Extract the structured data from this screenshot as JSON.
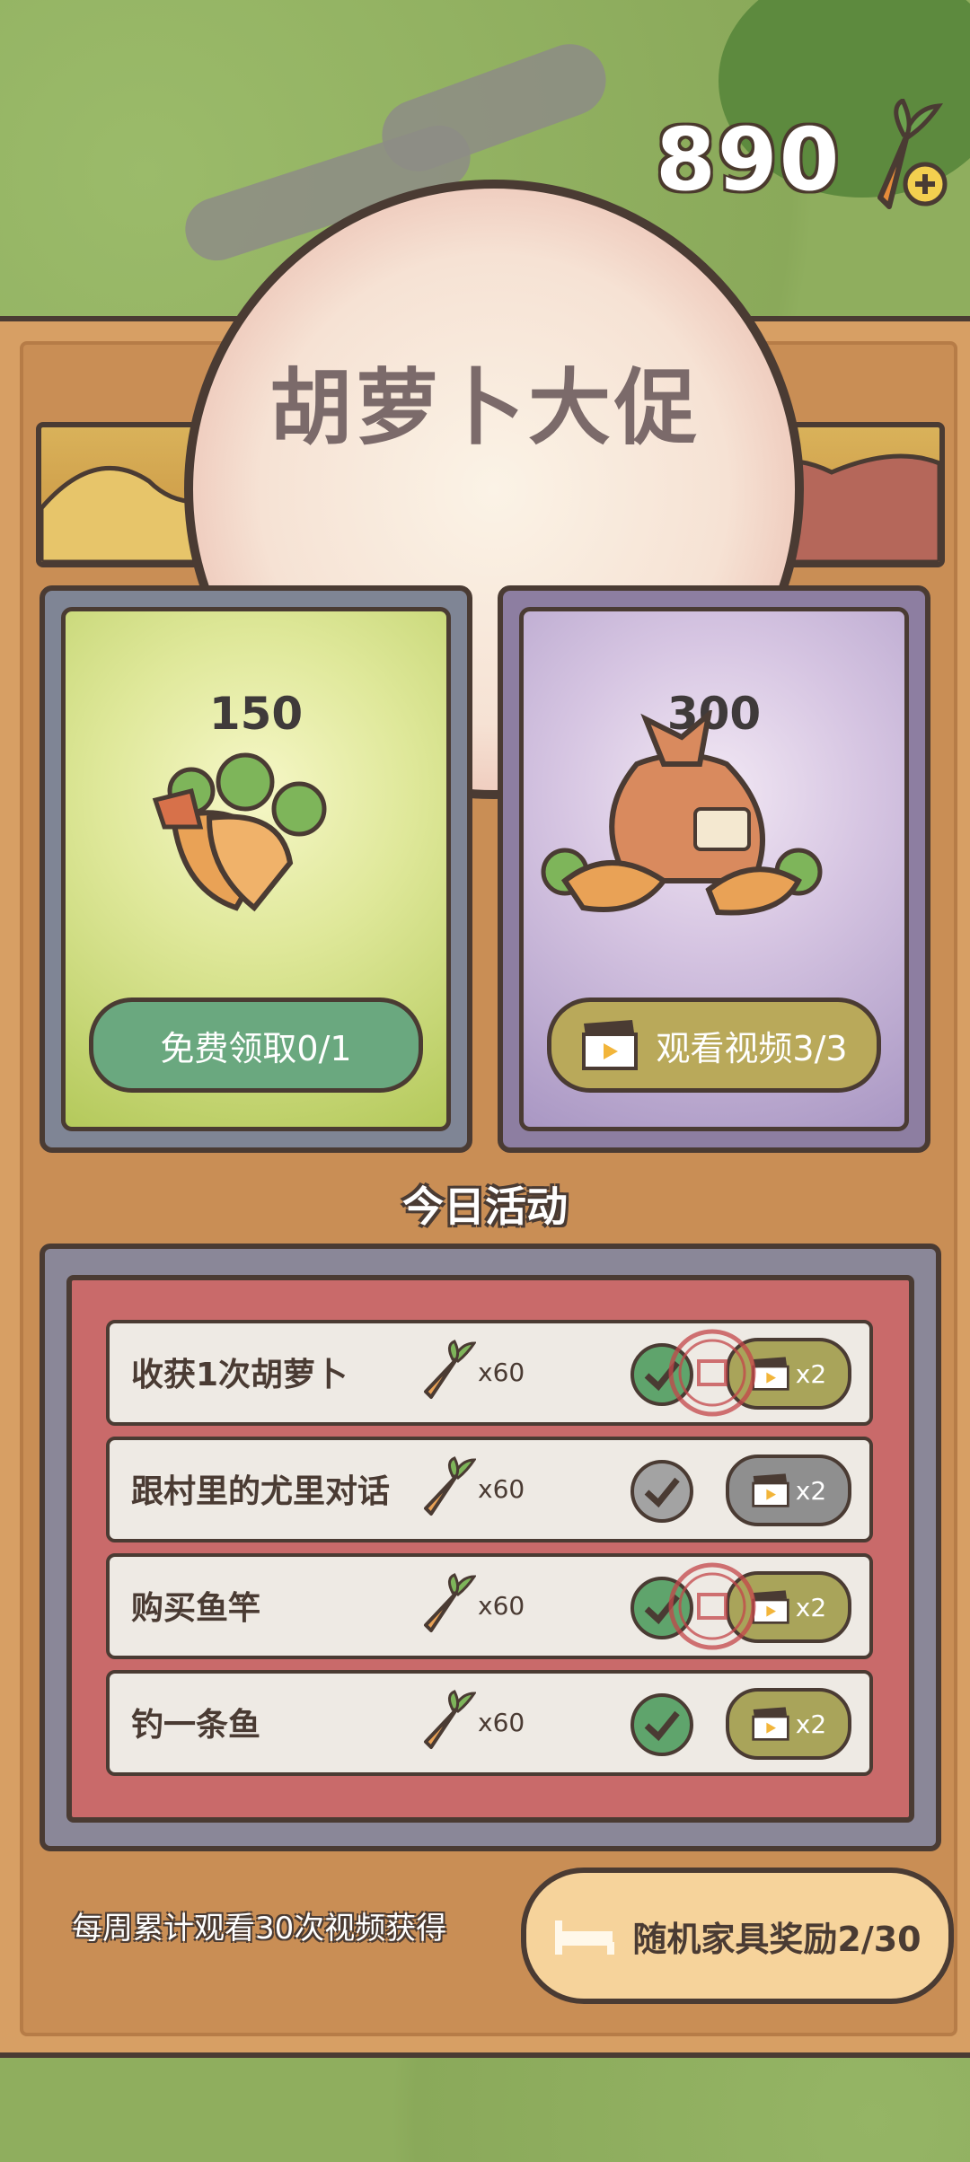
{
  "currency": {
    "amount": "890",
    "icon": "carrot-plus-icon"
  },
  "title": "胡萝卜大促",
  "cards": [
    {
      "amount": "150",
      "button_label": "免费领取0/1",
      "icon": "carrot-bundle-icon"
    },
    {
      "amount": "300",
      "button_label": "观看视频3/3",
      "icon": "carrot-sack-icon"
    }
  ],
  "activity": {
    "heading": "今日活动",
    "rows": [
      {
        "name": "收获1次胡萝卜",
        "reward": "x60",
        "completed": true,
        "stamped": true,
        "video_label": "x2"
      },
      {
        "name": "跟村里的尤里对话",
        "reward": "x60",
        "completed": false,
        "stamped": false,
        "video_label": "x2"
      },
      {
        "name": "购买鱼竿",
        "reward": "x60",
        "completed": true,
        "stamped": true,
        "video_label": "x2"
      },
      {
        "name": "钓一条鱼",
        "reward": "x60",
        "completed": true,
        "stamped": false,
        "video_label": "x2"
      }
    ]
  },
  "weekly": {
    "label": "每周累计观看30次视频获得",
    "button_label": "随机家具奖励2/30"
  },
  "colors": {
    "panel": "#d79f64",
    "outline": "#4a3b33",
    "free_button": "#6aa87f",
    "video_button": "#b9a95a"
  }
}
